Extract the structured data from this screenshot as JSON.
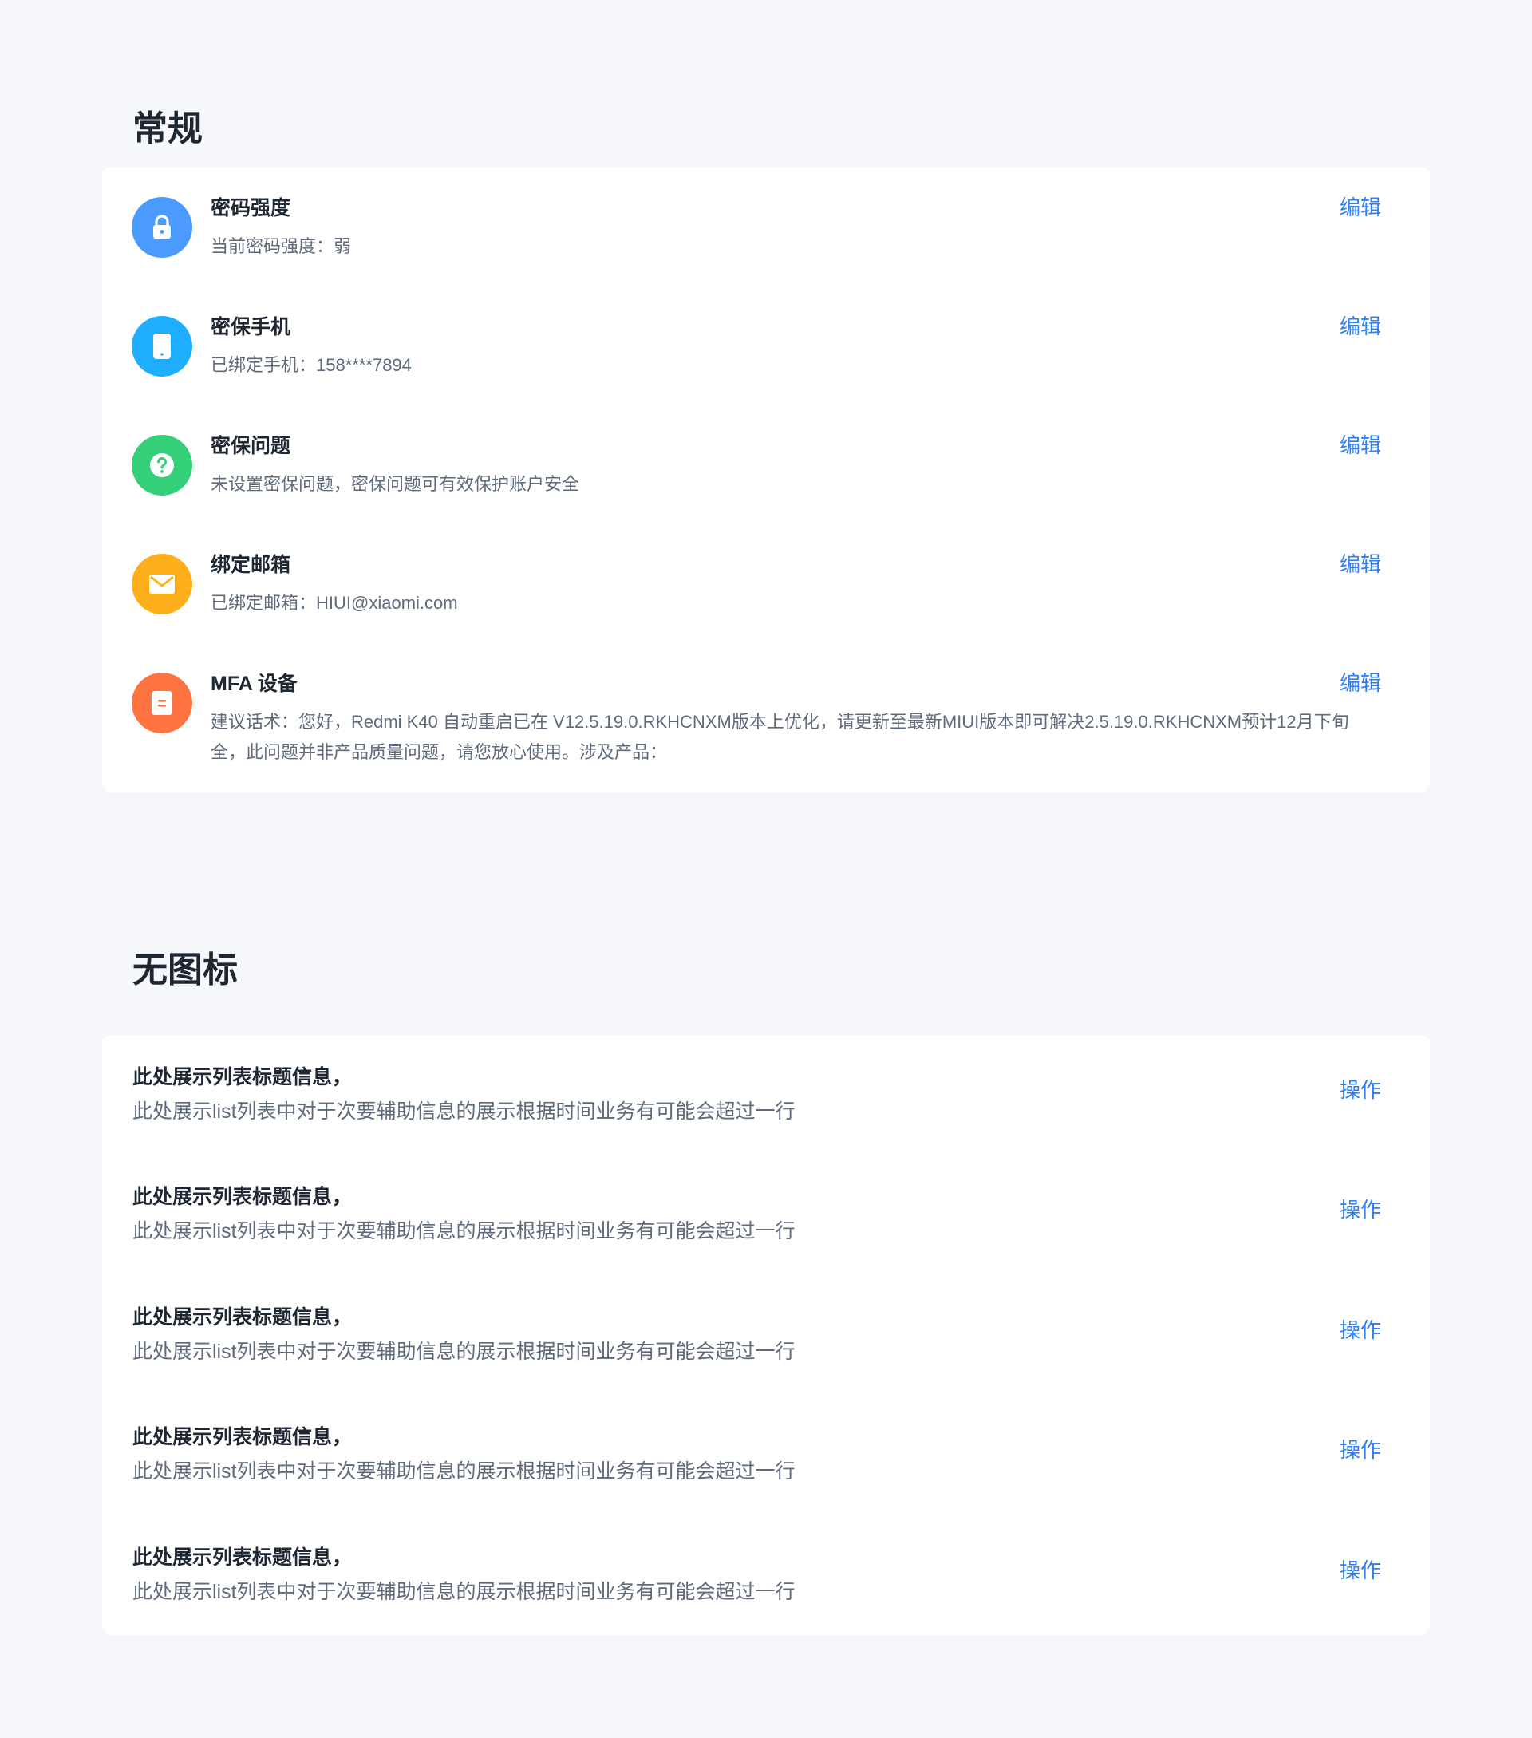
{
  "sections": {
    "general_title": "常规",
    "no_icon_title": "无图标"
  },
  "general": {
    "items": [
      {
        "icon": "lock-icon",
        "color": "#4b9bff",
        "title": "密码强度",
        "desc": "当前密码强度：弱",
        "action": "编辑"
      },
      {
        "icon": "phone-icon",
        "color": "#1faeff",
        "title": "密保手机",
        "desc": "已绑定手机：158****7894",
        "action": "编辑"
      },
      {
        "icon": "question-icon",
        "color": "#35d07a",
        "title": "密保问题",
        "desc": "未设置密保问题，密保问题可有效保护账户安全",
        "action": "编辑"
      },
      {
        "icon": "mail-icon",
        "color": "#fdb01b",
        "title": "绑定邮箱",
        "desc": "已绑定邮箱：HIUI@xiaomi.com",
        "action": "编辑"
      },
      {
        "icon": "document-icon",
        "color": "#ff7440",
        "title": "MFA 设备",
        "desc": "建议话术：您好，Redmi K40 自动重启已在 V12.5.19.0.RKHCNXM版本上优化，请更新至最新MIUI版本即可解决2.5.19.0.RKHCNXM预计12月下旬全，此问题并非产品质量问题，请您放心使用。涉及产品：",
        "action": "编辑"
      }
    ]
  },
  "no_icon": {
    "items": [
      {
        "title": "此处展示列表标题信息，",
        "desc": "此处展示list列表中对于次要辅助信息的展示根据时间业务有可能会超过一行",
        "action": "操作"
      },
      {
        "title": "此处展示列表标题信息，",
        "desc": "此处展示list列表中对于次要辅助信息的展示根据时间业务有可能会超过一行",
        "action": "操作"
      },
      {
        "title": "此处展示列表标题信息，",
        "desc": "此处展示list列表中对于次要辅助信息的展示根据时间业务有可能会超过一行",
        "action": "操作"
      },
      {
        "title": "此处展示列表标题信息，",
        "desc": "此处展示list列表中对于次要辅助信息的展示根据时间业务有可能会超过一行",
        "action": "操作"
      },
      {
        "title": "此处展示列表标题信息，",
        "desc": "此处展示list列表中对于次要辅助信息的展示根据时间业务有可能会超过一行",
        "action": "操作"
      }
    ]
  }
}
